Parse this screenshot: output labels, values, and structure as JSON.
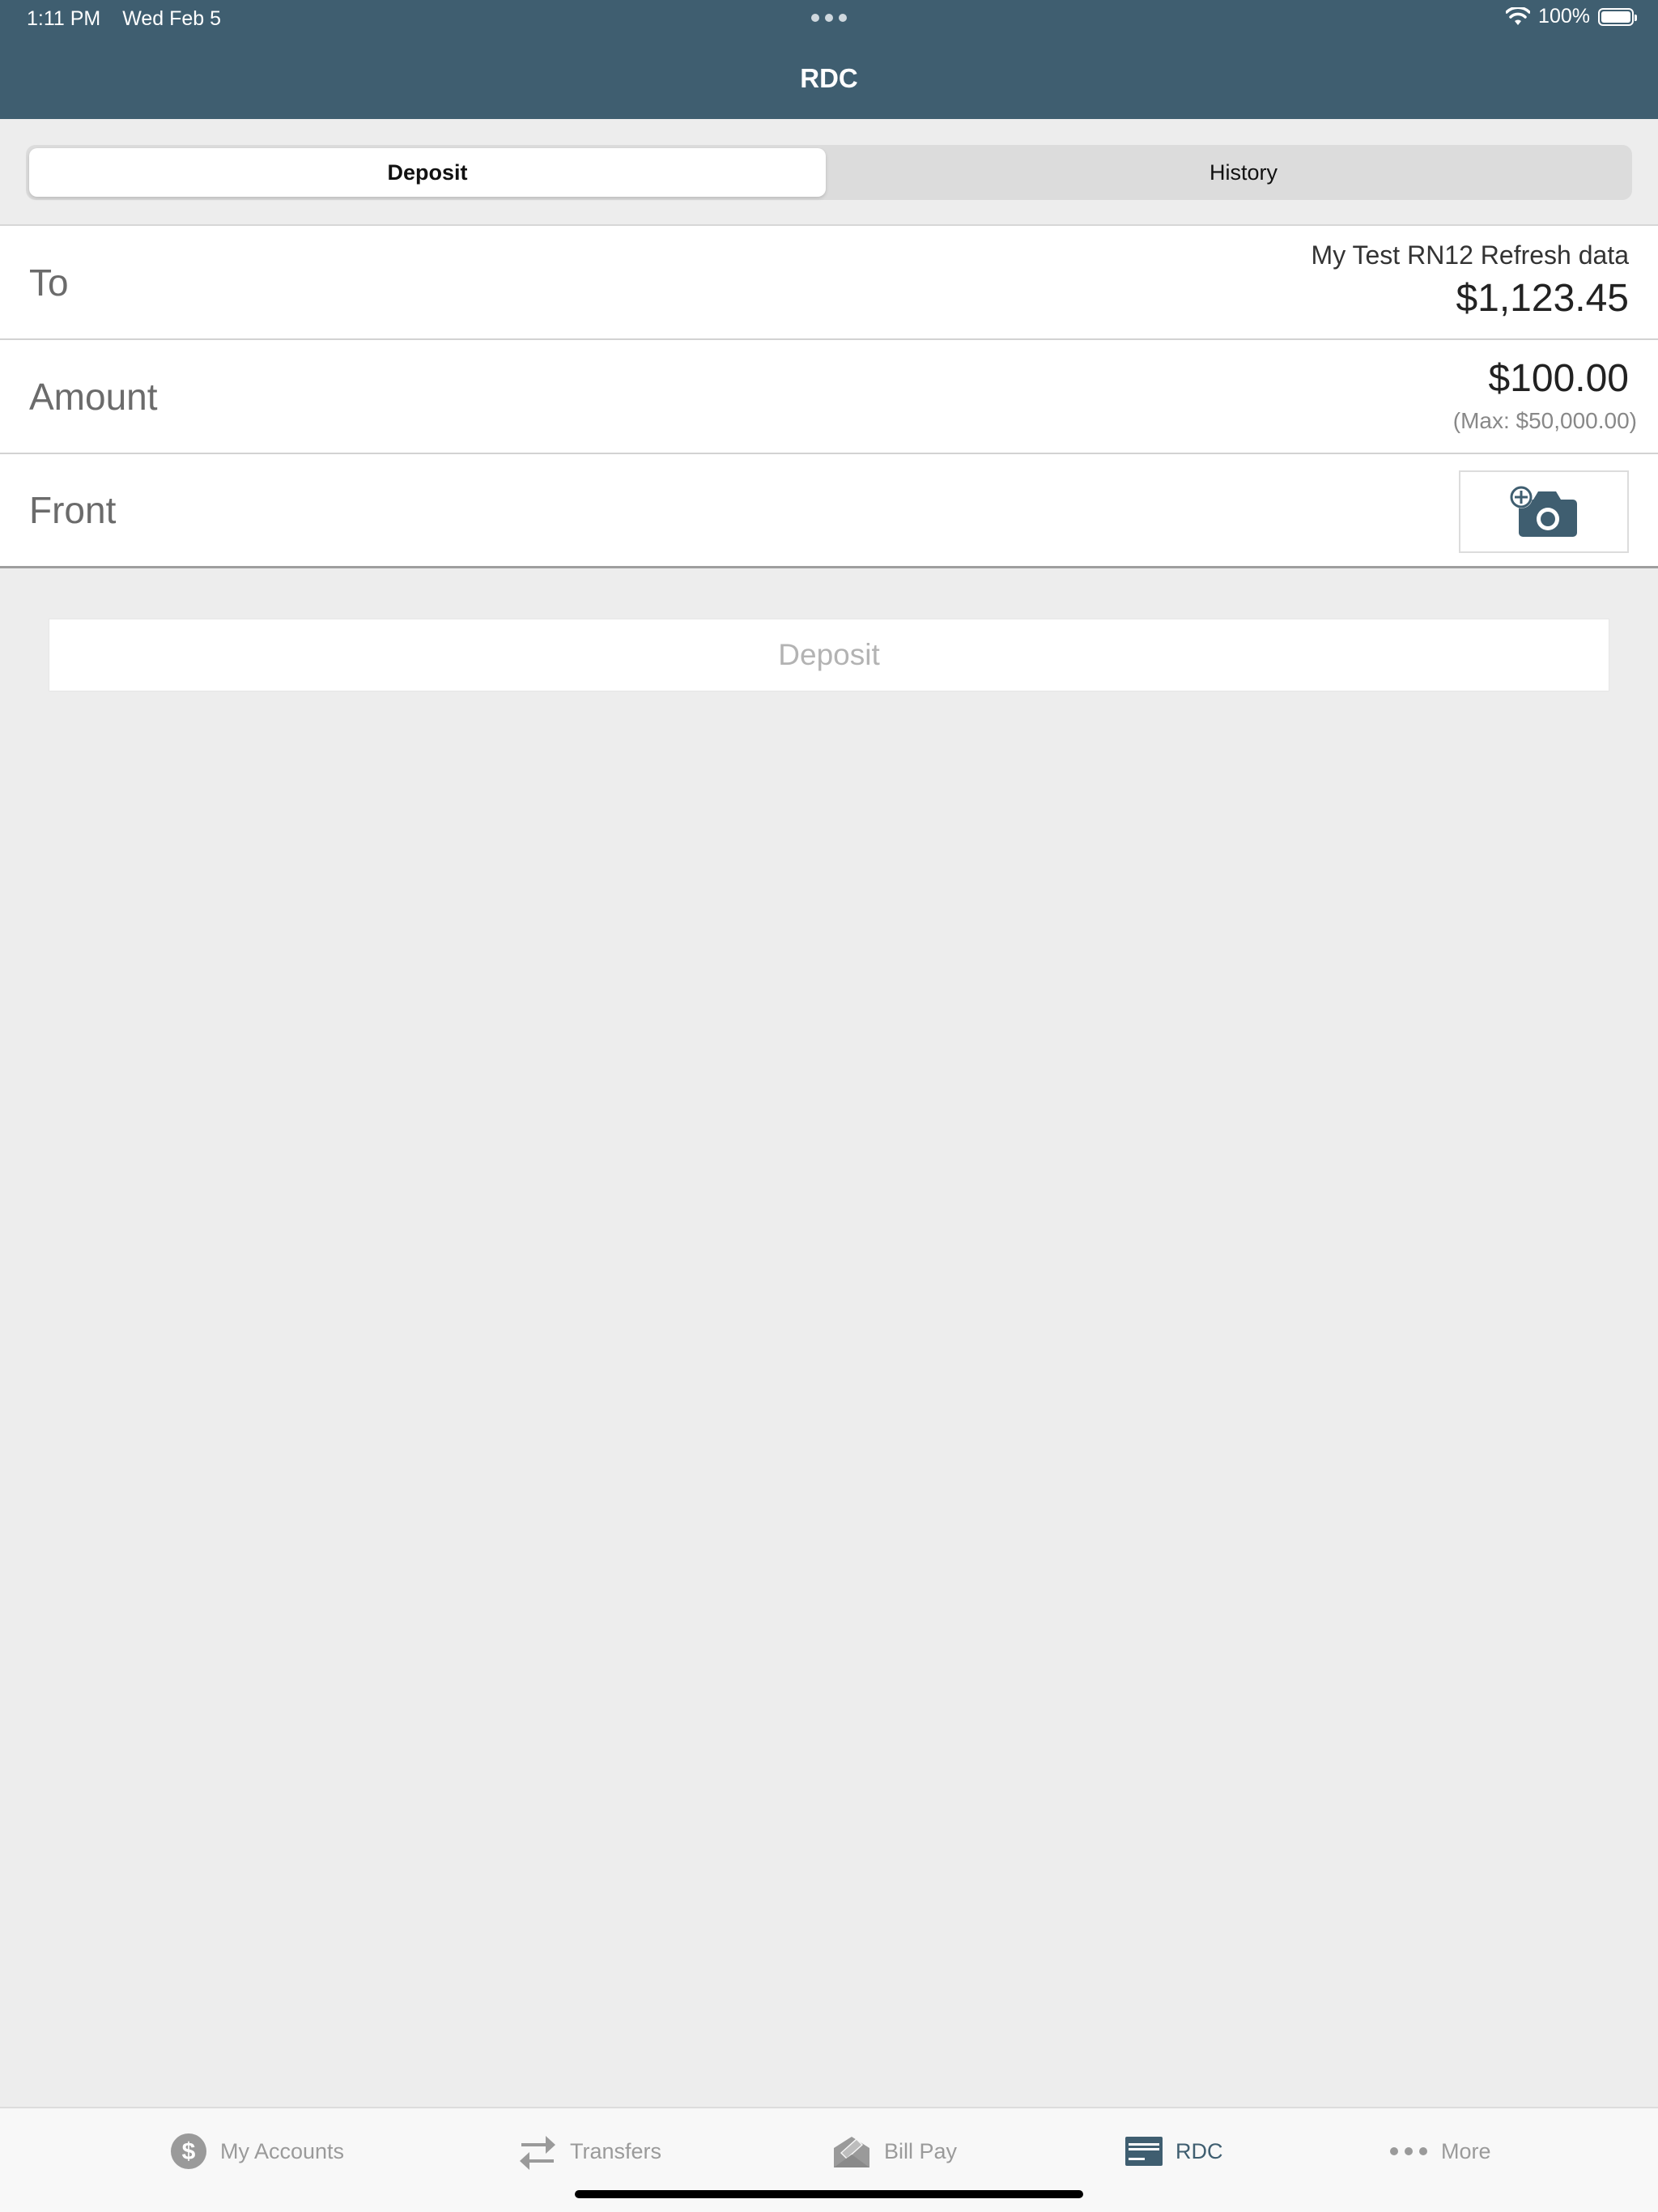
{
  "status_bar": {
    "time": "1:11 PM",
    "date": "Wed Feb 5",
    "battery": "100%"
  },
  "header": {
    "title": "RDC"
  },
  "segments": {
    "deposit": "Deposit",
    "history": "History",
    "active": "Deposit"
  },
  "form": {
    "to": {
      "label": "To",
      "account_name": "My Test RN12 Refresh data",
      "balance": "$1,123.45"
    },
    "amount": {
      "label": "Amount",
      "value": "$100.00",
      "max": "(Max: $50,000.00)"
    },
    "front": {
      "label": "Front",
      "icon": "camera-add-icon"
    }
  },
  "deposit_button": {
    "label": "Deposit",
    "enabled": false
  },
  "tabbar": {
    "active": "RDC",
    "items": [
      {
        "label": "My Accounts",
        "icon": "dollar-circle-icon"
      },
      {
        "label": "Transfers",
        "icon": "transfer-arrows-icon"
      },
      {
        "label": "Bill Pay",
        "icon": "bill-pay-icon"
      },
      {
        "label": "RDC",
        "icon": "check-card-icon"
      },
      {
        "label": "More",
        "icon": "more-dots-icon"
      }
    ]
  },
  "colors": {
    "header": "#3f5e70",
    "background": "#ededed",
    "active_tab": "#3f5e70",
    "inactive_tab": "#9a9a9a"
  }
}
